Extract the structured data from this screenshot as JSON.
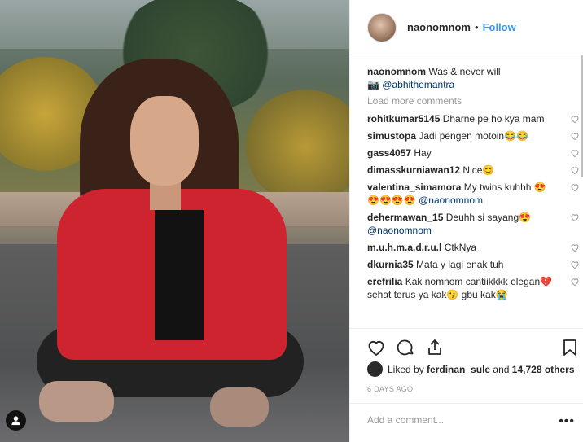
{
  "header": {
    "username": "naonomnom",
    "separator": "•",
    "follow_label": "Follow"
  },
  "caption": {
    "username": "naonomnom",
    "text": "Was & never will",
    "camera_emoji": "📷",
    "mention": "@abhithemantra"
  },
  "load_more": "Load more comments",
  "comments": [
    {
      "user": "rohitkumar5145",
      "text": "Dharne pe ho kya mam"
    },
    {
      "user": "simustopa",
      "text": "Jadi pengen motoin😂😂"
    },
    {
      "user": "gass4057",
      "text": "Hay"
    },
    {
      "user": "dimasskurniawan12",
      "text": "Nice😊"
    },
    {
      "user": "valentina_simamora",
      "text": "My twins kuhhh 😍😍😍😍😍",
      "mention": "@naonomnom"
    },
    {
      "user": "dehermawan_15",
      "text": "Deuhh si sayang😍",
      "mention": "@naonomnom"
    },
    {
      "user": "m.u.h.m.a.d.r.u.l",
      "text": "CtkNya"
    },
    {
      "user": "dkurnia35",
      "text": "Mata y lagi enak tuh"
    },
    {
      "user": "erefrilia",
      "text": "Kak nomnom cantiikkkk elegan💔 sehat terus ya kak😗 gbu kak😭"
    }
  ],
  "likes": {
    "prefix": "Liked by",
    "user": "ferdinan_sule",
    "middle": "and",
    "count": "14,728 others"
  },
  "timestamp": "6 DAYS AGO",
  "add_comment_placeholder": "Add a comment...",
  "more_label": "•••",
  "icons": {
    "like": "heart-icon",
    "comment": "comment-icon",
    "share": "share-icon",
    "save": "bookmark-icon",
    "user": "user-icon"
  },
  "colors": {
    "accent": "#3897f0",
    "mention": "#003569",
    "muted": "#999999"
  }
}
